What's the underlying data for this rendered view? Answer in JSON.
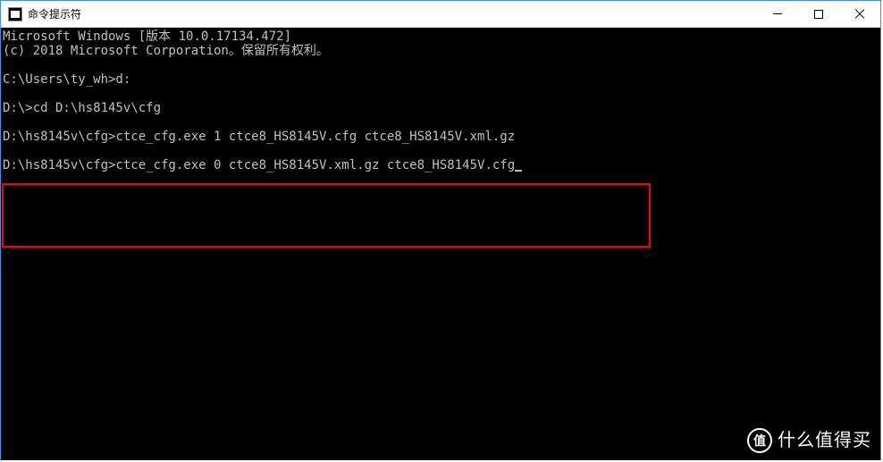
{
  "window": {
    "title": "命令提示符",
    "icon_text": "C:\\"
  },
  "terminal": {
    "lines": [
      "Microsoft Windows [版本 10.0.17134.472]",
      "(c) 2018 Microsoft Corporation。保留所有权利。",
      "",
      "C:\\Users\\ty_wh>d:",
      "",
      "D:\\>cd D:\\hs8145v\\cfg",
      "",
      "D:\\hs8145v\\cfg>ctce_cfg.exe 1 ctce8_HS8145V.cfg ctce8_HS8145V.xml.gz",
      "",
      "D:\\hs8145v\\cfg>ctce_cfg.exe 0 ctce8_HS8145V.xml.gz ctce8_HS8145V.cfg"
    ]
  },
  "watermark": {
    "logo_text": "值",
    "text": "什么值得买"
  }
}
